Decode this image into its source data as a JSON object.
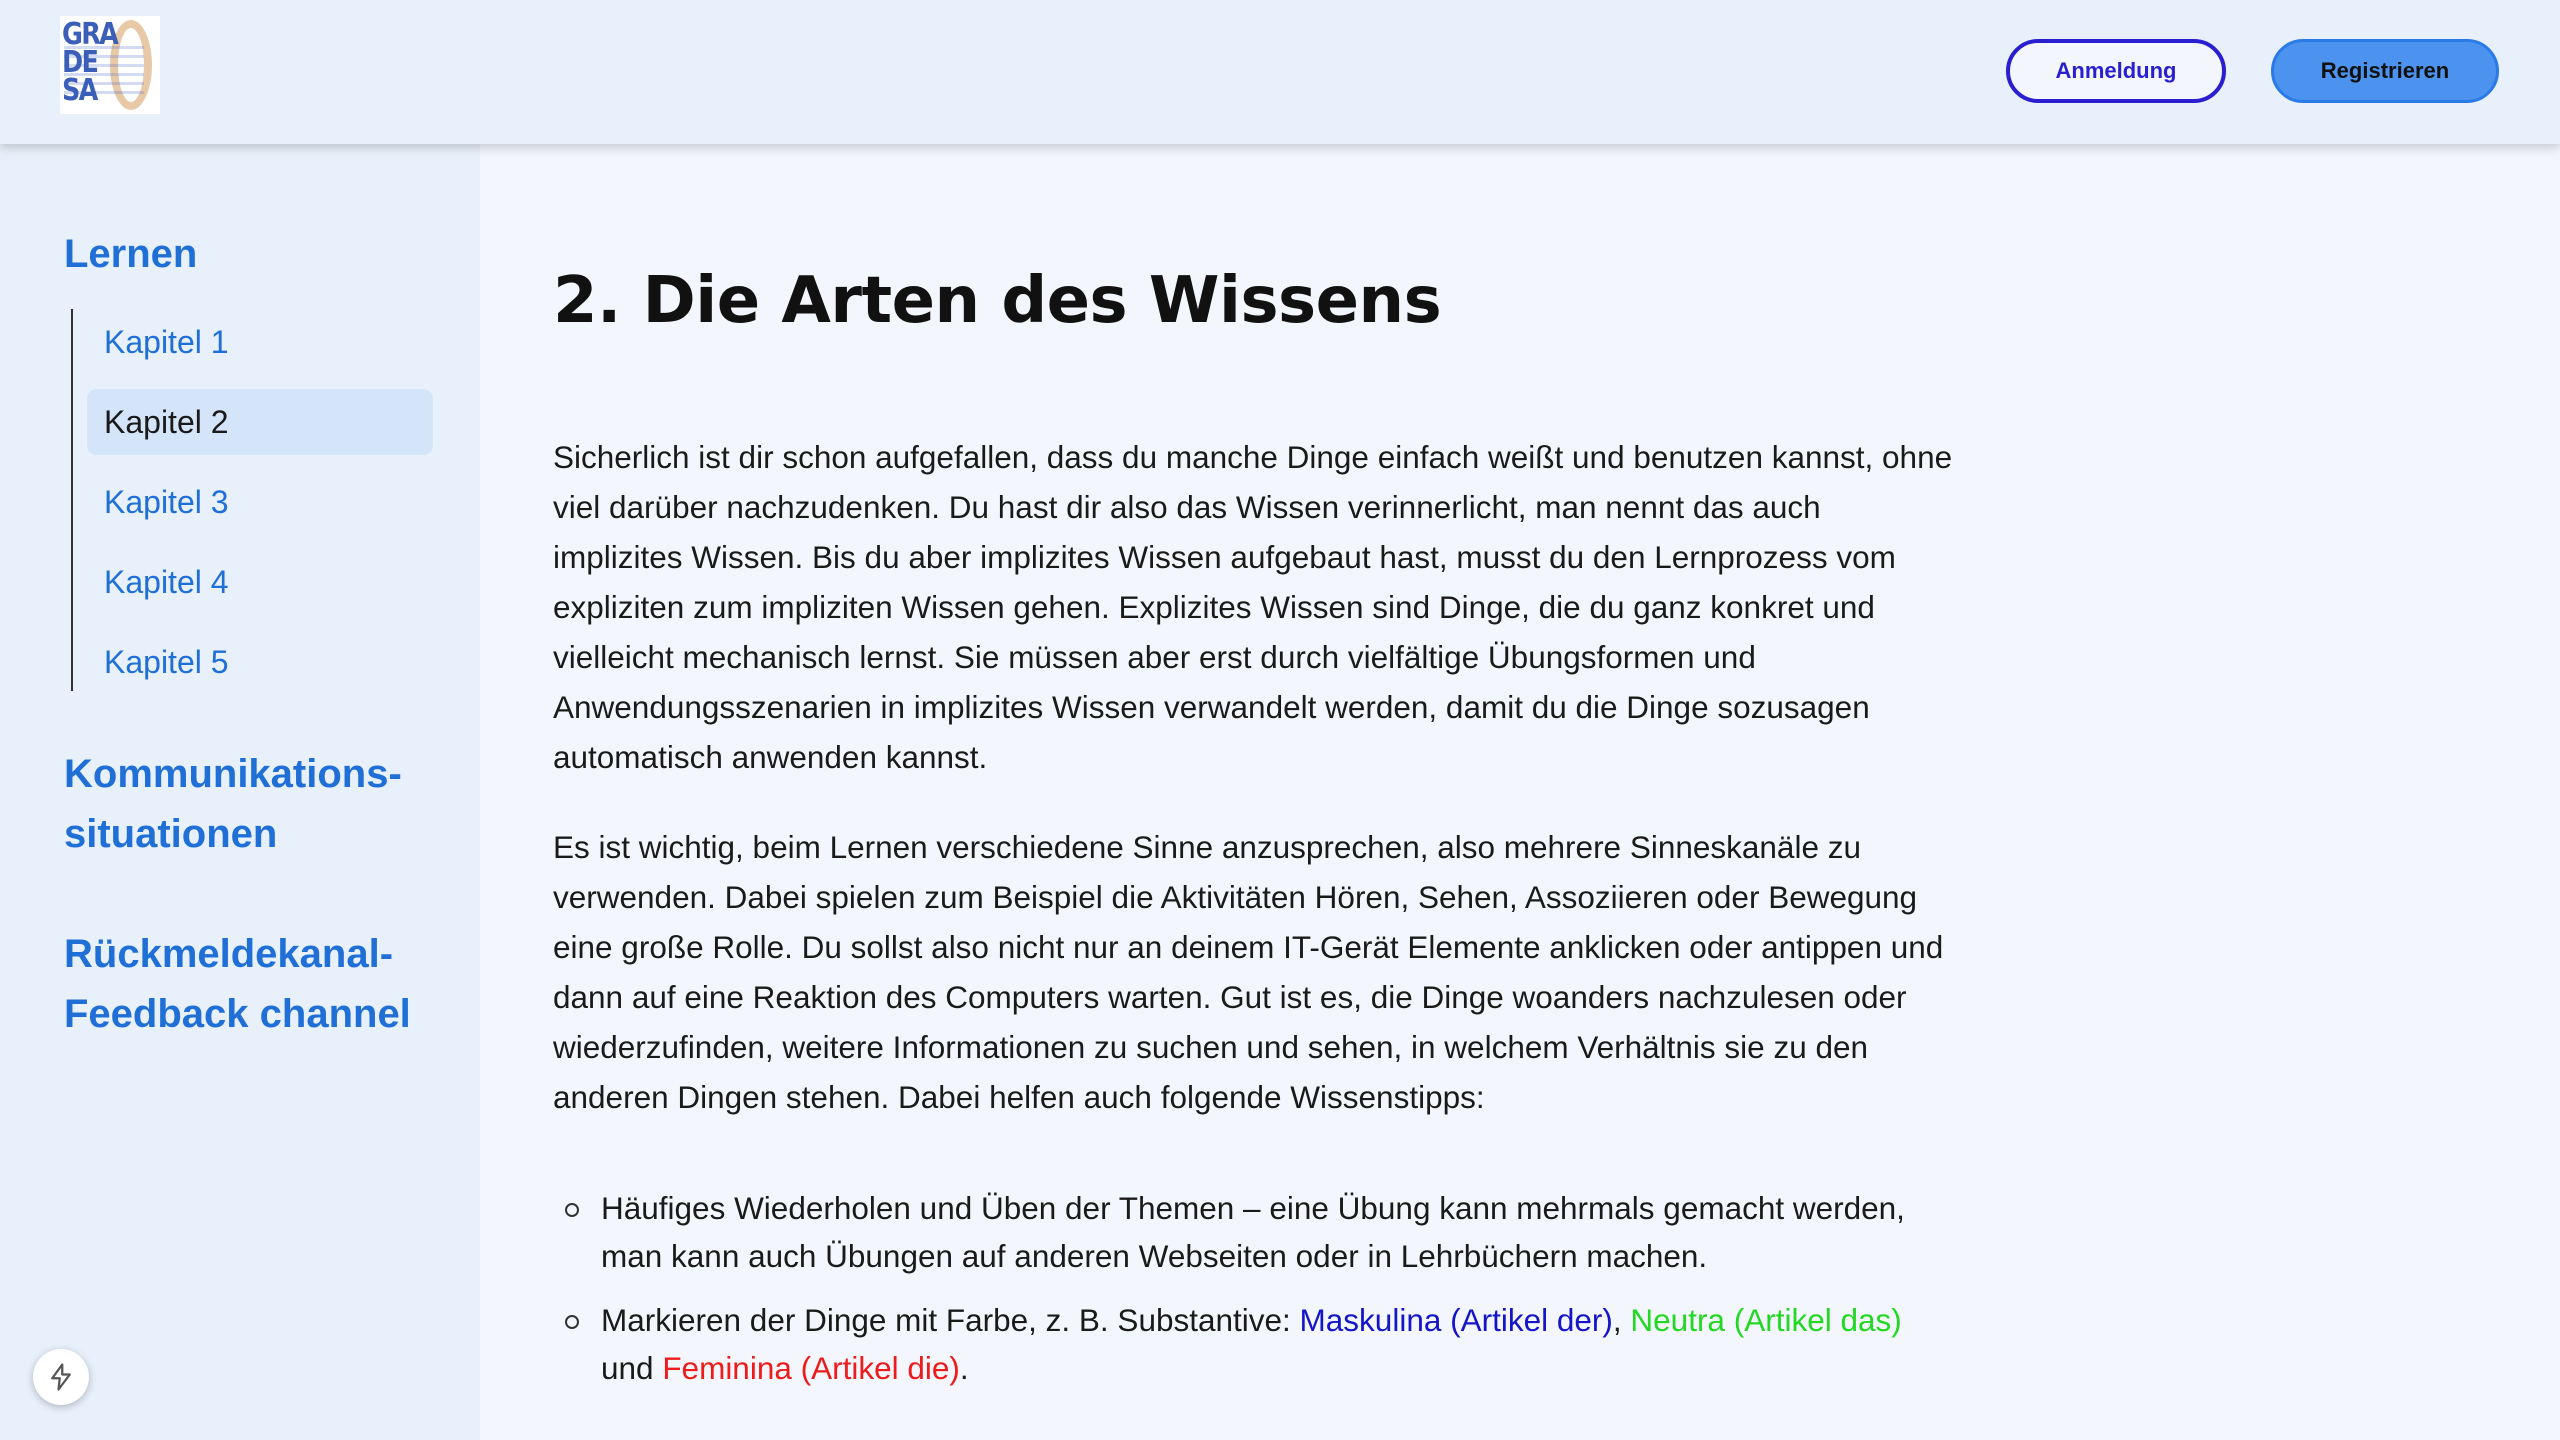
{
  "header": {
    "logo": "GRADESA 2.0",
    "login_label": "Anmeldung",
    "register_label": "Registrieren"
  },
  "sidebar": {
    "learn_heading": "Lernen",
    "chapters": [
      "Kapitel 1",
      "Kapitel 2",
      "Kapitel 3",
      "Kapitel 4",
      "Kapitel 5"
    ],
    "active_chapter": "Kapitel 2",
    "communication_heading_line1": "Kommunikations-",
    "communication_heading_line2": "situationen",
    "feedback_heading_line1": "Rückmeldekanal-",
    "feedback_heading_line2": "Feedback channel"
  },
  "main": {
    "title": "2. Die Arten des Wissens",
    "paragraph1": "Sicherlich ist dir schon aufgefallen, dass du manche Dinge einfach weißt und benutzen kannst, ohne viel darüber nachzudenken. Du hast dir also das Wissen verinnerlicht, man nennt das auch implizites Wissen. Bis du aber implizites Wissen aufgebaut hast, musst du den Lernprozess vom expliziten zum impliziten Wissen gehen. Explizites Wissen sind Dinge, die du ganz konkret und vielleicht mechanisch lernst. Sie müssen aber erst durch vielfältige Übungsformen und Anwendungsszenarien in implizites Wissen verwandelt werden, damit du die Dinge sozusagen automatisch anwenden kannst.",
    "paragraph2": "Es ist wichtig, beim Lernen verschiedene Sinne anzusprechen, also mehrere Sinneskanäle zu verwenden. Dabei spielen zum Beispiel die Aktivitäten Hören, Sehen, Assoziieren oder Bewegung eine große Rolle. Du sollst also nicht nur an deinem IT-Gerät Elemente anklicken oder antippen und dann auf eine Reaktion des Computers warten. Gut ist es, die Dinge woanders nachzulesen oder wiederzufinden, weitere Informationen zu suchen und sehen, in welchem Verhältnis sie zu den anderen Dingen stehen. Dabei helfen auch folgende Wissenstipps:",
    "tip1": "Häufiges Wiederholen und Üben der Themen – eine Übung kann mehrmals gemacht werden, man kann auch Übungen auf anderen Webseiten oder in Lehrbüchern machen.",
    "tip2_prefix": "Markieren der Dinge mit Farbe, z. B. Substantive: ",
    "tip2_masc": "Maskulina (Artikel der)",
    "tip2_sep1": ", ",
    "tip2_neut": "Neutra (Artikel das)",
    "tip2_sep2": " und ",
    "tip2_fem": "Feminina (Artikel die)",
    "tip2_end": "."
  },
  "colors": {
    "accent": "#1f6fd6",
    "masculine": "#1414c8",
    "neuter": "#22d822",
    "feminine": "#ee1b1b"
  },
  "icons": {
    "dev_tools": "lightning-bolt-icon"
  }
}
